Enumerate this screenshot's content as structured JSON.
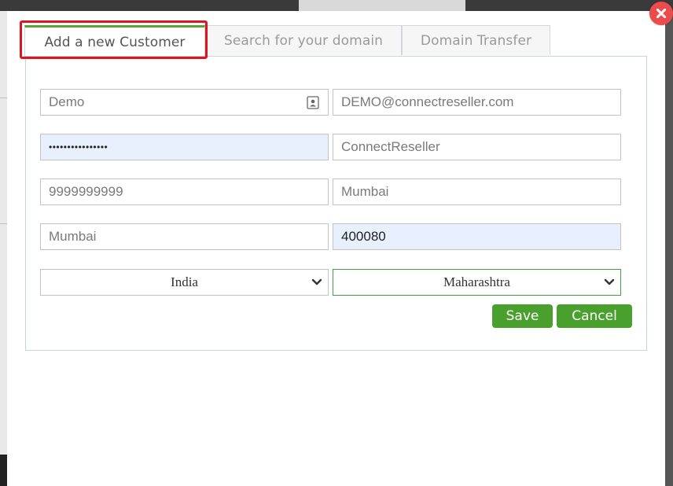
{
  "tabs": [
    {
      "label": "Add a new Customer",
      "active": true
    },
    {
      "label": "Search for your domain",
      "active": false
    },
    {
      "label": "Domain Transfer",
      "active": false
    }
  ],
  "form": {
    "name": {
      "value": "Demo",
      "kind": "placeholder"
    },
    "email": {
      "value": "DEMO@connectreseller.com",
      "kind": "placeholder"
    },
    "password": {
      "value": "••••••••••••••••",
      "autofilled": true
    },
    "company": {
      "value": "ConnectReseller",
      "kind": "placeholder"
    },
    "phone": {
      "value": "9999999999",
      "kind": "placeholder"
    },
    "address": {
      "value": "Mumbai",
      "kind": "placeholder"
    },
    "city": {
      "value": "Mumbai",
      "kind": "placeholder"
    },
    "zip": {
      "value": "400080",
      "autofilled": true
    },
    "country": {
      "selected": "India"
    },
    "state": {
      "selected": "Maharashtra"
    }
  },
  "buttons": {
    "save": "Save",
    "cancel": "Cancel"
  },
  "icons": {
    "close": "close-icon",
    "contact": "contact-card-icon",
    "dropdown": "chevron-down-icon"
  },
  "colors": {
    "accent_green": "#4aa02c",
    "close_red": "#ec4c4c",
    "highlight_red": "#e0141e",
    "autofill_bg": "#e8f0fe"
  }
}
